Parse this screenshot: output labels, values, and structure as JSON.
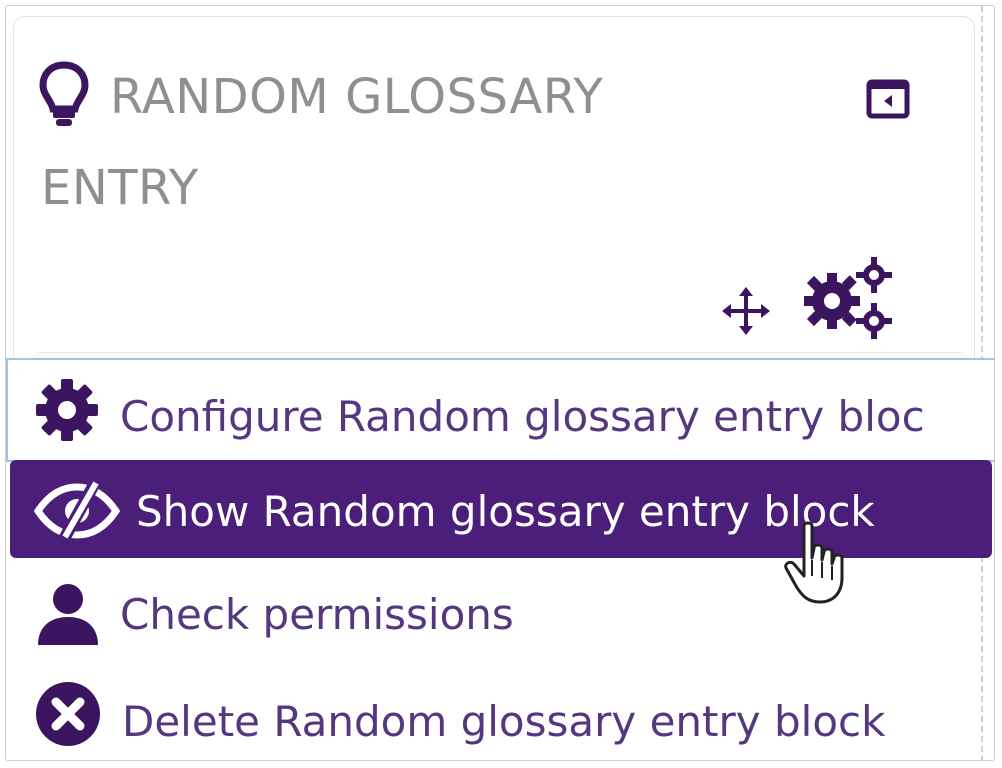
{
  "colors": {
    "accent": "#4b1e7a",
    "menu_text": "#55377f",
    "title_text": "#8f8f8f",
    "focus_border": "#9fc3ec"
  },
  "block": {
    "title_line1": "RANDOM GLOSSARY",
    "title_line2": "ENTRY",
    "title_icon": "lightbulb-icon",
    "collapse_icon": "collapse-block-icon",
    "move_icon": "move-icon",
    "actions_icon": "gears-icon"
  },
  "menu": {
    "items": [
      {
        "label": "Configure Random glossary entry bloc",
        "icon": "gear-icon"
      },
      {
        "label": "Show Random glossary entry block",
        "icon": "eye-slash-icon"
      },
      {
        "label": "Check permissions",
        "icon": "user-icon"
      },
      {
        "label": "Delete Random glossary entry block",
        "icon": "delete-circle-icon"
      }
    ]
  },
  "pointer": {
    "icon": "hand-pointer-icon"
  }
}
